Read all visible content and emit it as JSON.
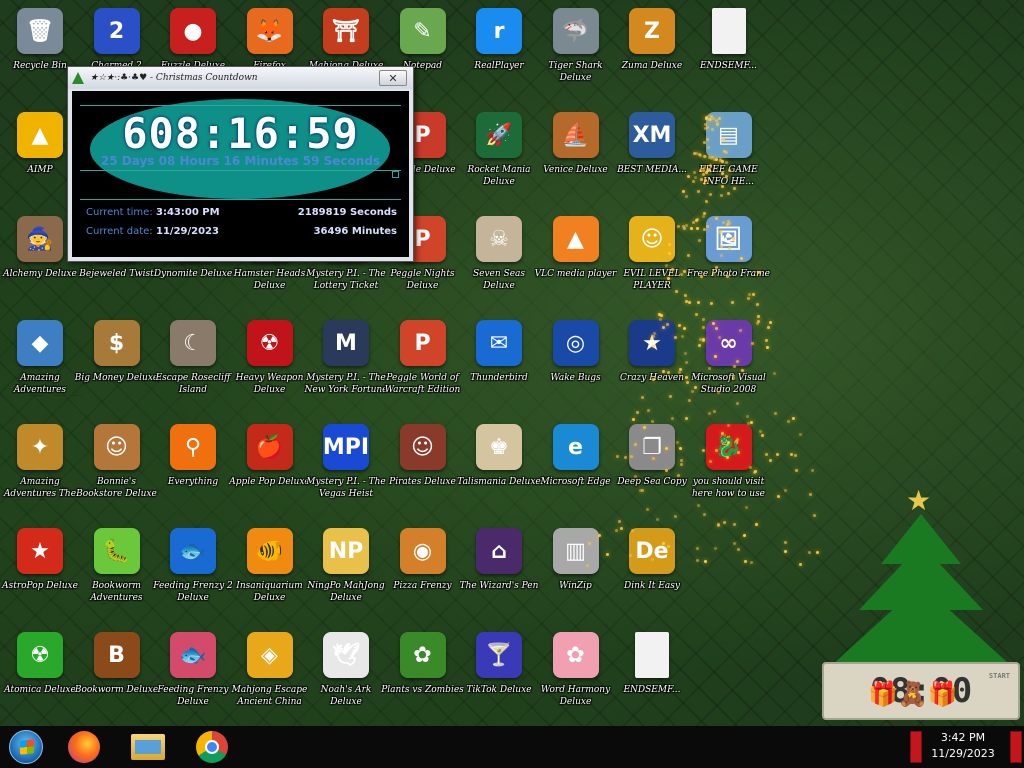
{
  "desktop": {
    "icons": [
      {
        "label": "Recycle Bin",
        "glyph": "🗑",
        "color": "#7b8a99",
        "icon": "recycle-bin-icon"
      },
      {
        "label": "Charmed 2 Deluxe",
        "glyph": "2",
        "color": "#2b4fc7",
        "icon": "charmed2-icon"
      },
      {
        "label": "Fuzzle Deluxe",
        "glyph": "●",
        "color": "#c8201e",
        "icon": "red-fuzzball-icon"
      },
      {
        "label": "Firefox",
        "glyph": "🦊",
        "color": "#e86a1e",
        "icon": "firefox-icon"
      },
      {
        "label": "Mahjong Deluxe",
        "glyph": "⛩",
        "color": "#c43d1c",
        "icon": "torii-icon"
      },
      {
        "label": "Notepad",
        "glyph": "✎",
        "color": "#6aa84f",
        "icon": "notepad-icon"
      },
      {
        "label": "RealPlayer",
        "glyph": "r",
        "color": "#1a8cf0",
        "icon": "realplayer-icon"
      },
      {
        "label": "Tiger Shark Deluxe",
        "glyph": "🦈",
        "color": "#7a8a90",
        "icon": "shark-icon"
      },
      {
        "label": "Zuma Deluxe",
        "glyph": "Z",
        "color": "#d4891e",
        "icon": "zuma-icon"
      },
      {
        "label": "ENDSEMF...",
        "glyph": "",
        "color": "#f2f2f2",
        "icon": "blank-file-icon"
      },
      {
        "label": "AIMP",
        "glyph": "▲",
        "color": "#f0b400",
        "icon": "aimp-icon"
      },
      {
        "label": "",
        "glyph": "",
        "color": "transparent",
        "icon": "hidden-icon"
      },
      {
        "label": "",
        "glyph": "",
        "color": "transparent",
        "icon": "hidden-icon"
      },
      {
        "label": "",
        "glyph": "",
        "color": "transparent",
        "icon": "hidden-icon"
      },
      {
        "label": "",
        "glyph": "",
        "color": "transparent",
        "icon": "hidden-icon"
      },
      {
        "label": "Pupple Deluxe",
        "glyph": "P",
        "color": "#c93a2a",
        "icon": "peggle-icon"
      },
      {
        "label": "Rocket Mania Deluxe",
        "glyph": "🚀",
        "color": "#1e6b3a",
        "icon": "rocket-icon"
      },
      {
        "label": "Venice Deluxe",
        "glyph": "⛵",
        "color": "#b5692a",
        "icon": "venice-icon"
      },
      {
        "label": "BEST MEDIA...",
        "glyph": "XM",
        "color": "#2d5c9c",
        "icon": "xmplay-icon"
      },
      {
        "label": "FREE GAME INFO HE...",
        "glyph": "▤",
        "color": "#6aa0c8",
        "icon": "window-icon"
      },
      {
        "label": "Alchemy Deluxe",
        "glyph": "🧙",
        "color": "#8a6a4a",
        "icon": "wizard-icon"
      },
      {
        "label": "Bejeweled Twist",
        "glyph": "",
        "color": "transparent",
        "icon": "bejeweled-icon"
      },
      {
        "label": "Dynomite Deluxe",
        "glyph": "",
        "color": "transparent",
        "icon": "dynomite-icon"
      },
      {
        "label": "Hamster Heads Deluxe",
        "glyph": "",
        "color": "transparent",
        "icon": "hamster-icon"
      },
      {
        "label": "Mystery P.I. - The Lottery Ticket",
        "glyph": "",
        "color": "transparent",
        "icon": "mystery-pi-icon"
      },
      {
        "label": "Peggle Nights Deluxe",
        "glyph": "P",
        "color": "#d0442a",
        "icon": "peggle-nights-icon"
      },
      {
        "label": "Seven Seas Deluxe",
        "glyph": "☠",
        "color": "#c4b49a",
        "icon": "skull-icon"
      },
      {
        "label": "VLC media player",
        "glyph": "▲",
        "color": "#f08020",
        "icon": "vlc-icon"
      },
      {
        "label": "EVIL LEVEL PLAYER",
        "glyph": "☺",
        "color": "#e6b21a",
        "icon": "smiley-icon"
      },
      {
        "label": "Free Photo Frame",
        "glyph": "🖼",
        "color": "#6a9cd4",
        "icon": "photo-icon"
      },
      {
        "label": "Amazing Adventures Around The World",
        "glyph": "◆",
        "color": "#3d7fc2",
        "icon": "diamond-icon"
      },
      {
        "label": "Big Money Deluxe",
        "glyph": "$",
        "color": "#a87a3a",
        "icon": "money-bag-icon"
      },
      {
        "label": "Escape Rosecliff Island",
        "glyph": "☾",
        "color": "#8a7a6a",
        "icon": "moon-icon"
      },
      {
        "label": "Heavy Weapon Deluxe",
        "glyph": "☢",
        "color": "#c0141a",
        "icon": "radiation-icon"
      },
      {
        "label": "Mystery P.I. - The New York Fortune",
        "glyph": "M",
        "color": "#2a3a5a",
        "icon": "shield-icon"
      },
      {
        "label": "Peggle World of Warcraft Edition",
        "glyph": "P",
        "color": "#d0442a",
        "icon": "peggle-wow-icon"
      },
      {
        "label": "Thunderbird",
        "glyph": "✉",
        "color": "#1a6ad4",
        "icon": "thunderbird-icon"
      },
      {
        "label": "Wake Bugs",
        "glyph": "◎",
        "color": "#1a4aa8",
        "icon": "porthole-icon"
      },
      {
        "label": "Crazy Heaven",
        "glyph": "★",
        "color": "#1a3a8a",
        "icon": "star-icon"
      },
      {
        "label": "Microsoft Visual Studio 2008",
        "glyph": "∞",
        "color": "#6a3aa8",
        "icon": "infinity-icon"
      },
      {
        "label": "Amazing Adventures The Lost Tomb",
        "glyph": "✦",
        "color": "#c08a2a",
        "icon": "compass-icon"
      },
      {
        "label": "Bonnie's Bookstore Deluxe",
        "glyph": "☺",
        "color": "#b5763a",
        "icon": "girl-face-icon"
      },
      {
        "label": "Everything",
        "glyph": "⚲",
        "color": "#f07010",
        "icon": "magnifier-icon"
      },
      {
        "label": "Apple Pop Deluxe",
        "glyph": "🍎",
        "color": "#c42a1a",
        "icon": "apple-icon"
      },
      {
        "label": "Mystery P.I. - The Vegas Heist",
        "glyph": "MPI",
        "color": "#1a4ad4",
        "icon": "mpi-icon"
      },
      {
        "label": "Pirates Deluxe",
        "glyph": "☺",
        "color": "#8a3a2a",
        "icon": "pirate-icon"
      },
      {
        "label": "Talismania Deluxe",
        "glyph": "♚",
        "color": "#d4c4a0",
        "icon": "king-icon"
      },
      {
        "label": "Microsoft Edge",
        "glyph": "e",
        "color": "#1a8ad4",
        "icon": "edge-icon"
      },
      {
        "label": "Deep Sea Copy",
        "glyph": "❐",
        "color": "#8a8a8a",
        "icon": "copy-icon"
      },
      {
        "label": "you should visit here how to use the system",
        "glyph": "🐉",
        "color": "#d41a1a",
        "icon": "dragon-icon"
      },
      {
        "label": "AstroPop Deluxe",
        "glyph": "★",
        "color": "#d42a1a",
        "icon": "astropop-icon"
      },
      {
        "label": "Bookworm Adventures Deluxe",
        "glyph": "🐛",
        "color": "#6ac83a",
        "icon": "bookworm-icon"
      },
      {
        "label": "Feeding Frenzy 2 Deluxe",
        "glyph": "🐟",
        "color": "#1a6ad4",
        "icon": "fish-icon"
      },
      {
        "label": "Insaniquarium Deluxe",
        "glyph": "🐠",
        "color": "#f08a10",
        "icon": "goldfish-icon"
      },
      {
        "label": "NingPo MahJong Deluxe",
        "glyph": "NP",
        "color": "#e8c04a",
        "icon": "ningpo-icon"
      },
      {
        "label": "Pizza Frenzy",
        "glyph": "◉",
        "color": "#d4802a",
        "icon": "pizza-icon"
      },
      {
        "label": "The Wizard's Pen",
        "glyph": "⌂",
        "color": "#4a2a6a",
        "icon": "tower-icon"
      },
      {
        "label": "WinZip",
        "glyph": "▥",
        "color": "#a8a8a8",
        "icon": "winzip-icon"
      },
      {
        "label": "Dink It Easy",
        "glyph": "De",
        "color": "#d49a1a",
        "icon": "de-icon"
      },
      {
        "label": "",
        "glyph": "",
        "color": "transparent",
        "icon": "hidden-icon"
      },
      {
        "label": "Atomica Deluxe",
        "glyph": "☢",
        "color": "#2aa82a",
        "icon": "atomica-icon"
      },
      {
        "label": "Bookworm Deluxe",
        "glyph": "B",
        "color": "#8a4a1a",
        "icon": "book-icon"
      },
      {
        "label": "Feeding Frenzy Deluxe",
        "glyph": "🐟",
        "color": "#d44a6a",
        "icon": "pink-fish-icon"
      },
      {
        "label": "Mahjong Escape Ancient China",
        "glyph": "◈",
        "color": "#e8a81a",
        "icon": "mahjong-tile-icon"
      },
      {
        "label": "Noah's Ark Deluxe",
        "glyph": "🕊",
        "color": "#e8e8e8",
        "icon": "dove-icon"
      },
      {
        "label": "Plants vs Zombies",
        "glyph": "✿",
        "color": "#3a8a2a",
        "icon": "plant-icon"
      },
      {
        "label": "TikTok Deluxe",
        "glyph": "🍸",
        "color": "#3a3ab8",
        "icon": "martini-icon"
      },
      {
        "label": "Word Harmony Deluxe",
        "glyph": "✿",
        "color": "#f0a0b0",
        "icon": "flower-icon"
      },
      {
        "label": "ENDSEMF...",
        "glyph": "",
        "color": "#f2f2f2",
        "icon": "blank-file-icon"
      },
      {
        "label": "",
        "glyph": "",
        "color": "transparent",
        "icon": "hidden-icon"
      }
    ]
  },
  "countdown": {
    "title": "★☆★·:♣·♣♥ - Christmas Countdown",
    "close": "✕",
    "time_remaining": "608:16:59",
    "time_remaining_long": "25 Days 08 Hours 16 Minutes 59 Seconds",
    "current_time_label": "Current time:",
    "current_time": "3:43:00 PM",
    "current_date_label": "Current date:",
    "current_date": "11/29/2023",
    "seconds": "2189819 Seconds",
    "minutes": "36496 Minutes"
  },
  "tree_widget": {
    "clock_digits": "08:00",
    "start_label": "START"
  },
  "taskbar": {
    "apps": [
      {
        "name": "firefox",
        "glyph": "🦊"
      },
      {
        "name": "file-explorer",
        "glyph": "📁"
      },
      {
        "name": "chrome",
        "glyph": "◉"
      }
    ],
    "clock_time": "3:42 PM",
    "clock_date": "11/29/2023"
  },
  "colors": {
    "countdown_bg": "#000000",
    "countdown_ellipse": "#0e8f87",
    "countdown_accent": "#4e86d6",
    "desktop_bg": "#1f3d1c"
  }
}
